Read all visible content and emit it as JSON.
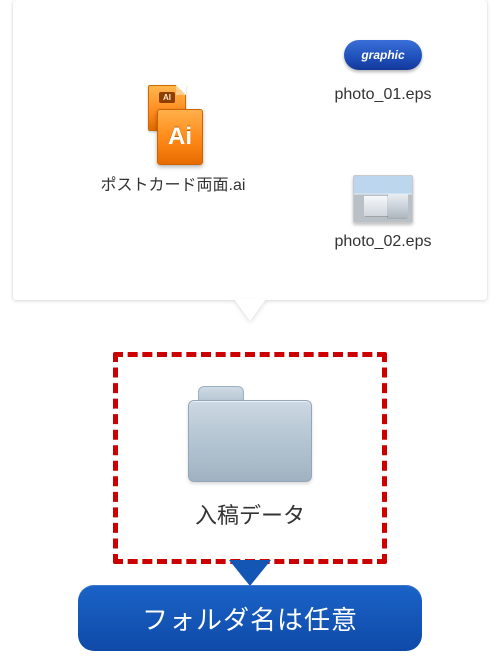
{
  "files": {
    "ai": {
      "filename": "ポストカード両面.ai",
      "badge": "AI",
      "iconText": "Ai"
    },
    "eps1": {
      "filename": "photo_01.eps",
      "logoText": "graphic"
    },
    "eps2": {
      "filename": "photo_02.eps"
    }
  },
  "folder": {
    "label": "入稿データ"
  },
  "caption": {
    "text": "フォルダ名は任意"
  },
  "colors": {
    "dashedBorder": "#cc0000",
    "pill": "#0f4aa8"
  }
}
